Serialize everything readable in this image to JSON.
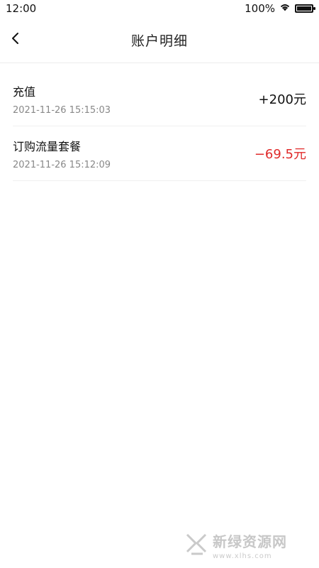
{
  "status_bar": {
    "time": "12:00",
    "battery_percent": "100%",
    "battery_level": 1.0
  },
  "header": {
    "title": "账户明细"
  },
  "transactions": [
    {
      "title": "充值",
      "time": "2021-11-26 15:15:03",
      "amount": "+200元",
      "type": "positive"
    },
    {
      "title": "订购流量套餐",
      "time": "2021-11-26 15:12:09",
      "amount": "−69.5元",
      "type": "negative"
    }
  ],
  "colors": {
    "negative": "#e02a2a",
    "primary_text": "#111111",
    "secondary_text": "#888888"
  },
  "watermark": {
    "text": "新绿资源网",
    "sub": "www.xlhs.com"
  }
}
